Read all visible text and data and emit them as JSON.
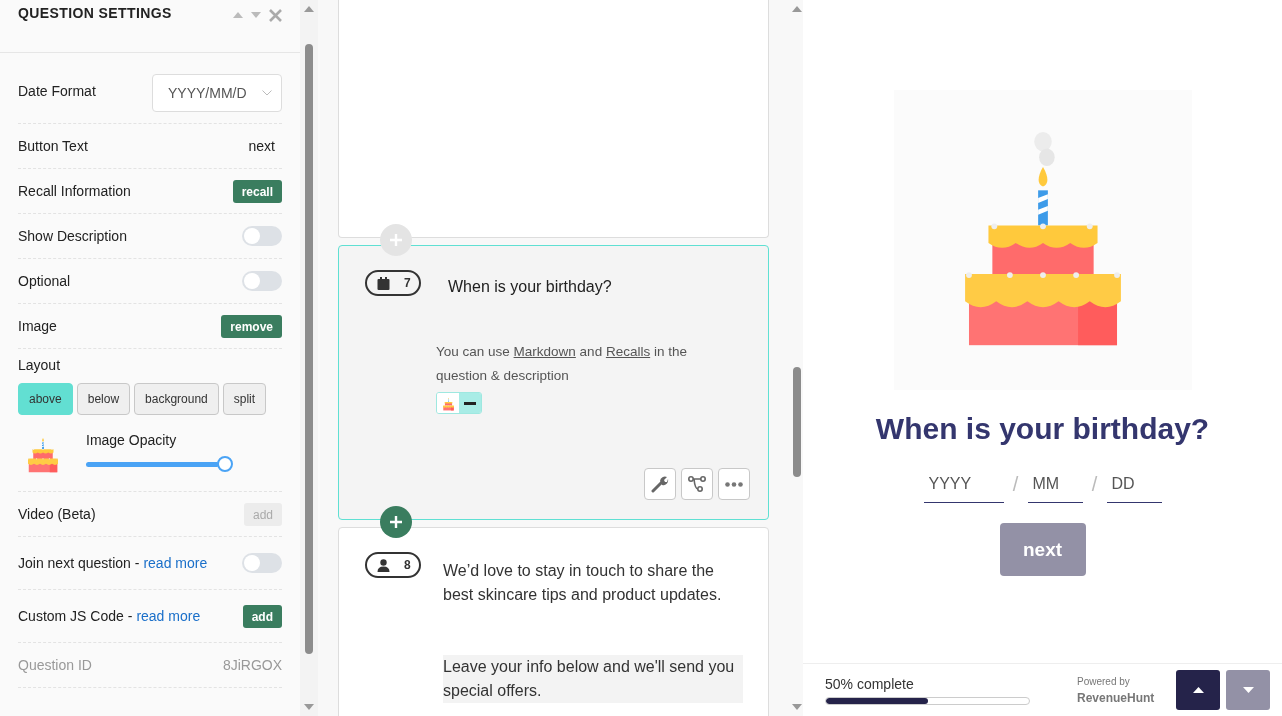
{
  "settings": {
    "title": "QUESTION SETTINGS",
    "rows": [
      {
        "kind": "select",
        "label": "Date Format",
        "value": "YYYY/MM/D"
      },
      {
        "kind": "text",
        "label": "Button Text",
        "value": "next"
      },
      {
        "kind": "button",
        "label": "Recall Information",
        "button": "recall",
        "disabled": false
      },
      {
        "kind": "toggle",
        "label": "Show Description",
        "on": false
      },
      {
        "kind": "toggle",
        "label": "Optional",
        "on": false
      },
      {
        "kind": "button",
        "label": "Image",
        "button": "remove",
        "disabled": false
      },
      {
        "kind": "layout",
        "label": "Layout",
        "options": [
          {
            "label": "above",
            "selected": true
          },
          {
            "label": "below",
            "selected": false
          },
          {
            "label": "background",
            "selected": false
          },
          {
            "label": "split",
            "selected": false
          }
        ]
      },
      {
        "kind": "opacity",
        "label": "Image Opacity",
        "level": 0.95
      },
      {
        "kind": "button",
        "label": "Video (Beta)",
        "button": "add",
        "disabled": true
      },
      {
        "kind": "toggle",
        "label": "Join next question -",
        "link": "read more",
        "on": false
      },
      {
        "kind": "button",
        "label": "Custom JS Code -",
        "link": "read more",
        "button": "add",
        "disabled": false
      },
      {
        "kind": "readonly",
        "label": "Question ID",
        "value": "8JiRGOX"
      }
    ]
  },
  "builder": {
    "cards": [
      {
        "kind": "blank",
        "selected": false
      },
      {
        "kind": "date",
        "number": "7",
        "title": "When is your birthday?",
        "selected": true,
        "add_above": {
          "highlighted": false
        },
        "image_attached": true,
        "description": [
          {
            "text": "You can use "
          },
          {
            "text": "Markdown",
            "link": true
          },
          {
            "text": " and "
          },
          {
            "text": "Recalls",
            "link": true
          },
          {
            "text": " in the question & description"
          }
        ]
      },
      {
        "kind": "contact",
        "number": "8",
        "selected": false,
        "add_above": {
          "highlighted": true
        },
        "paragraphs": [
          {
            "text": "We’d love to stay in touch to share the best skincare tips and product updates.",
            "highlighted": false
          },
          {
            "text": "Leave your info below and we'll send you special offers.",
            "highlighted": true
          }
        ]
      }
    ]
  },
  "preview": {
    "title": "When is your birthday?",
    "date_fields": [
      {
        "kind": "year",
        "placeholder": "YYYY"
      },
      {
        "kind": "month",
        "placeholder": "MM"
      },
      {
        "kind": "day",
        "placeholder": "DD"
      }
    ],
    "separators": [
      "/",
      "/"
    ],
    "next_button": {
      "label": "next",
      "disabled": true
    },
    "progress": {
      "label": "50% complete",
      "level": 0.5
    },
    "powered_by": "Powered by",
    "brand": "RevenueHunt",
    "nav": [
      {
        "kind": "up",
        "disabled": false
      },
      {
        "kind": "down",
        "disabled": true
      }
    ]
  }
}
